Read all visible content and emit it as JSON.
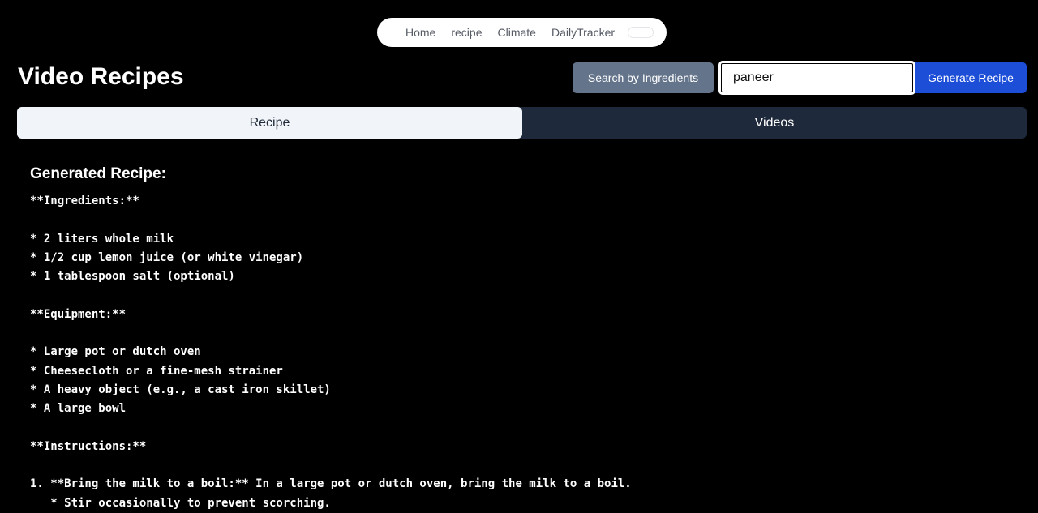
{
  "nav": {
    "links": [
      "Home",
      "recipe",
      "Climate",
      "DailyTracker"
    ]
  },
  "header": {
    "title": "Video Recipes",
    "search_by_ingredients_label": "Search by Ingredients",
    "search_value": "paneer",
    "generate_label": "Generate Recipe"
  },
  "tabs": {
    "recipe": "Recipe",
    "videos": "Videos"
  },
  "recipe": {
    "heading": "Generated Recipe:",
    "body": "**Ingredients:**\n\n* 2 liters whole milk\n* 1/2 cup lemon juice (or white vinegar)\n* 1 tablespoon salt (optional)\n\n**Equipment:**\n\n* Large pot or dutch oven\n* Cheesecloth or a fine-mesh strainer\n* A heavy object (e.g., a cast iron skillet)\n* A large bowl\n\n**Instructions:**\n\n1. **Bring the milk to a boil:** In a large pot or dutch oven, bring the milk to a boil.\n   * Stir occasionally to prevent scorching."
  },
  "colors": {
    "background": "#000000",
    "search_button": "#64748b",
    "generate_button": "#1d4ed8",
    "tab_active": "#f1f5f9",
    "tab_inactive": "#1e293b"
  }
}
